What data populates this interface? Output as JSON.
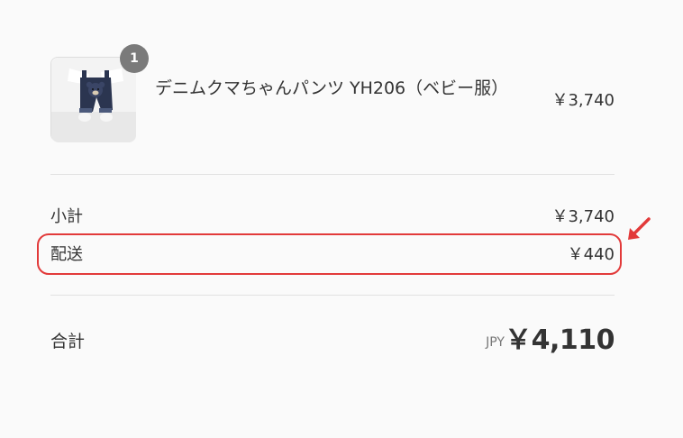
{
  "product": {
    "quantity": "1",
    "name": "デニムクマちゃんパンツ YH206（ベビー服）",
    "price": "￥3,740",
    "thumbnail_icon": "baby-bear-pants-image"
  },
  "summary": {
    "subtotal_label": "小計",
    "subtotal_value": "￥3,740",
    "shipping_label": "配送",
    "shipping_value": "￥440"
  },
  "total": {
    "label": "合計",
    "currency": "JPY",
    "value": "￥4,110"
  },
  "annotation": {
    "highlight_color": "#e23a3a",
    "arrow_icon": "red-arrow-icon"
  },
  "colors": {
    "background": "#fafafa",
    "text": "#333333",
    "badge": "#7a7a7a",
    "divider": "#e1e1e1"
  }
}
